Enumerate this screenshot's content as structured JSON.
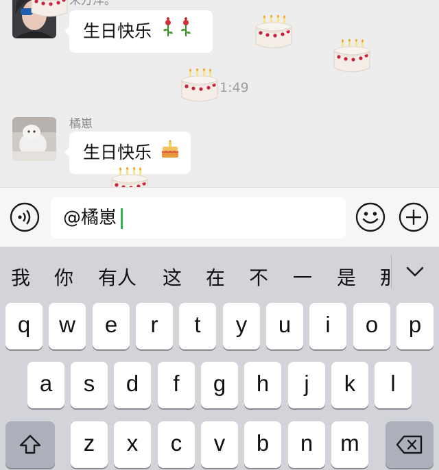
{
  "chat": {
    "messages": [
      {
        "sender": "宋方洋。",
        "text": "生日快乐",
        "emoji": "🌹🌹"
      },
      {
        "sender": "橘崽",
        "text": "生日快乐",
        "emoji": "🎂"
      }
    ],
    "timestamp": "1:49"
  },
  "input": {
    "value": "@橘崽",
    "voice_icon": "voice-icon",
    "emoji_icon": "emoji-icon",
    "plus_icon": "plus-icon"
  },
  "keyboard": {
    "candidates": [
      "我",
      "你",
      "有人",
      "这",
      "在",
      "不",
      "一",
      "是",
      "那"
    ],
    "collapse_icon": "chevron-down-icon",
    "row1": [
      "q",
      "w",
      "e",
      "r",
      "t",
      "y",
      "u",
      "i",
      "o",
      "p"
    ],
    "row2": [
      "a",
      "s",
      "d",
      "f",
      "g",
      "h",
      "j",
      "k",
      "l"
    ],
    "row3": [
      "z",
      "x",
      "c",
      "v",
      "b",
      "n",
      "m"
    ],
    "shift_icon": "shift-icon",
    "delete_icon": "delete-icon"
  }
}
